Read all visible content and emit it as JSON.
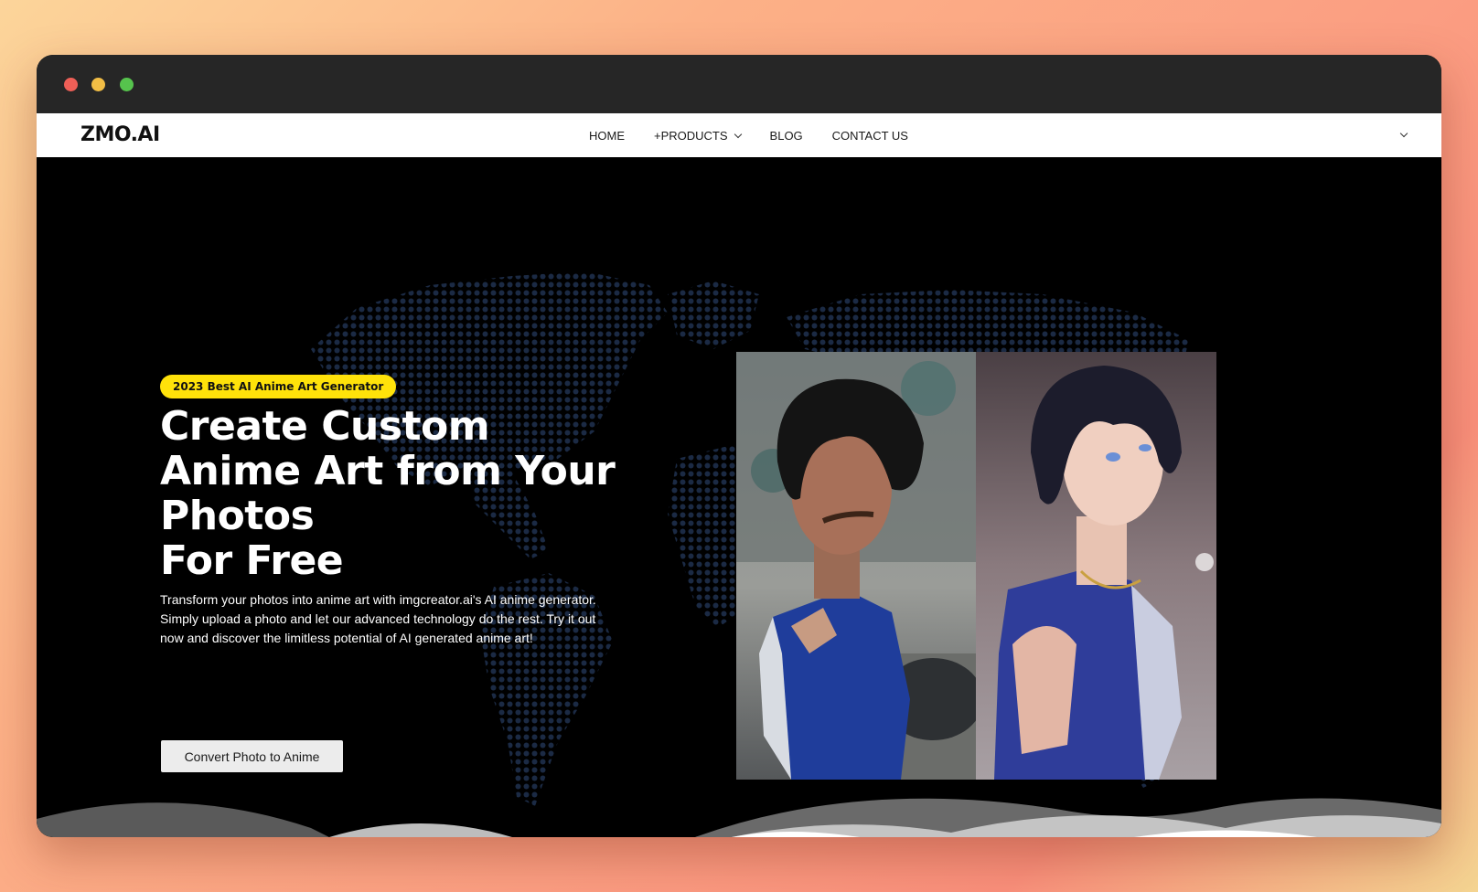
{
  "site": {
    "logo": "ZMO.AI"
  },
  "nav": {
    "items": [
      {
        "label": "HOME"
      },
      {
        "label": "+PRODUCTS"
      },
      {
        "label": "BLOG"
      },
      {
        "label": "CONTACT US"
      }
    ]
  },
  "hero": {
    "badge": "2023 Best AI Anime Art Generator",
    "headline_lines": [
      "Create Custom",
      "Anime Art from Your",
      "Photos",
      "For Free"
    ],
    "description": "Transform your photos into anime art with imgcreator.ai's AI anime generator. Simply upload a photo and let our advanced technology do the rest. Try it out now and discover the limitless potential of AI generated anime art!",
    "cta_label": "Convert Photo to Anime"
  },
  "colors": {
    "badge_bg": "#ffe20a",
    "hero_bg": "#000000",
    "navbar_bg": "#ffffff",
    "titlebar_bg": "#262626",
    "map_dot": "#1b2a44"
  }
}
